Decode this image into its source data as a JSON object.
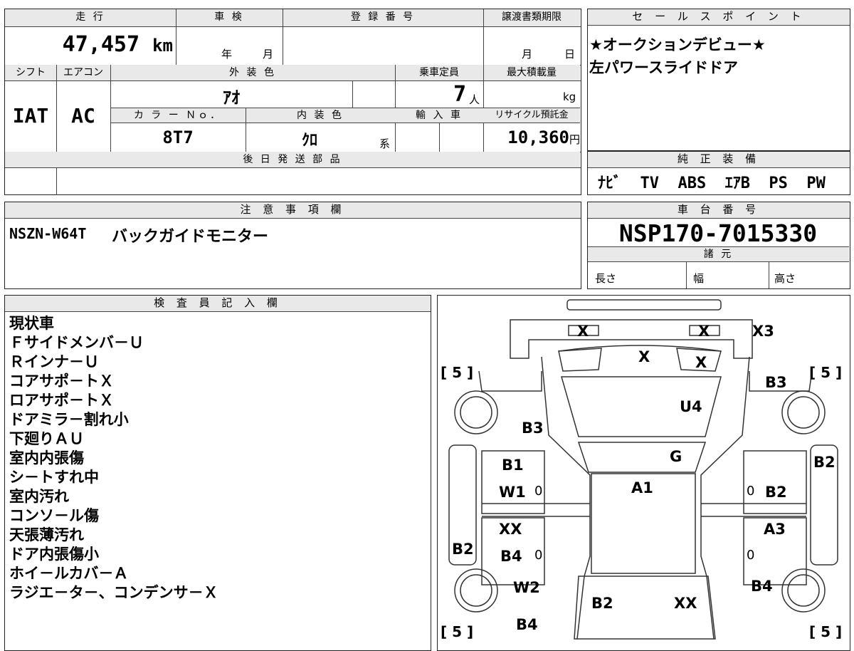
{
  "top_table": {
    "mileage_label": "走 行",
    "mileage": "47,457",
    "mileage_unit": "km",
    "inspection_label": "車 検",
    "year_unit": "年",
    "month_unit": "月",
    "reg_label": "登 録 番 号",
    "transfer_label": "譲渡書類期限",
    "transfer_month": "月",
    "transfer_day": "日",
    "shift_label": "シフト",
    "aircon_label": "エアコン",
    "exterior_label": "外 装 色",
    "capacity_label": "乗車定員",
    "maxload_label": "最大積載量",
    "shift": "IAT",
    "aircon": "AC",
    "exterior": "ｱｵ",
    "capacity": "7",
    "capacity_unit": "人",
    "load_unit": "kg",
    "color_no_label": "カ ラ ー Ｎｏ．",
    "interior_label": "内 装 色",
    "import_label": "輸 入 車",
    "recycle_label": "リサイクル預託金",
    "color_no": "8T7",
    "interior": "ｸﾛ",
    "interior_suffix": "系",
    "recycle": "10,360",
    "recycle_unit": "円",
    "later_parts_label": "後 日 発 送 部 品"
  },
  "sales_points": {
    "label": "セ ー ル ス ポ イ ン ト",
    "lines": [
      "★オークションデビュー★",
      "左パワースライドドア"
    ]
  },
  "equipment": {
    "label": "純 正 装 備",
    "value": "ﾅﾋﾞ  TV  ABS  ｴｱB  PS  PW"
  },
  "notes": {
    "label": "注 意 事 項 欄",
    "code": "NSZN-W64T",
    "text": "バックガイドモニター"
  },
  "chassis": {
    "label": "車 台 番 号",
    "value": "NSP170-7015330"
  },
  "specs": {
    "label": "諸 元",
    "length": "長さ",
    "width": "幅",
    "height": "高さ"
  },
  "inspector": {
    "label": "検 査 員 記 入 欄",
    "lines": [
      "現状車",
      "Ｆサイドメンバ－Ｕ",
      "Ｒインナ－Ｕ",
      "コアサポ－トＸ",
      "ロアサポ－トＸ",
      "ドアミラ－割れ小",
      "下廻りＡＵ",
      "室内内張傷",
      "シ－トすれ中",
      "室内汚れ",
      "コンソ－ル傷",
      "天張薄汚れ",
      "ドア内張傷小",
      "ホイ－ルカバ－Ａ",
      "ラジエ－タ－、コンデンサ－Ｘ"
    ]
  },
  "diagram": {
    "tire_marks": {
      "fl": "[ 5 ]",
      "fr": "[ 5 ]",
      "rl": "[ 5 ]",
      "rr": "[ 5 ]"
    },
    "marks": {
      "bumper_left": "X",
      "bumper_right": "X",
      "bumper_corner": "X3",
      "grille_center": "X",
      "grille_right": "X",
      "hood": "U4",
      "fender_left": "B3",
      "fender_right": "B3",
      "windshield": "G",
      "roof": "A1",
      "front_door_left_1": "B1",
      "front_door_left_2": "W1",
      "front_door_right": "B2",
      "pillar_right": "B2",
      "rear_door_left_1": "XX",
      "rear_door_left_2": "B4",
      "rear_door_right": "A3",
      "side_left": "B2",
      "quarter_left": "W2",
      "quarter_right": "B4",
      "rear_left_low": "B4",
      "tailgate_left": "B2",
      "tailgate_right": "XX",
      "zero_1": "0",
      "zero_2": "0",
      "zero_3": "0",
      "zero_4": "0"
    }
  }
}
